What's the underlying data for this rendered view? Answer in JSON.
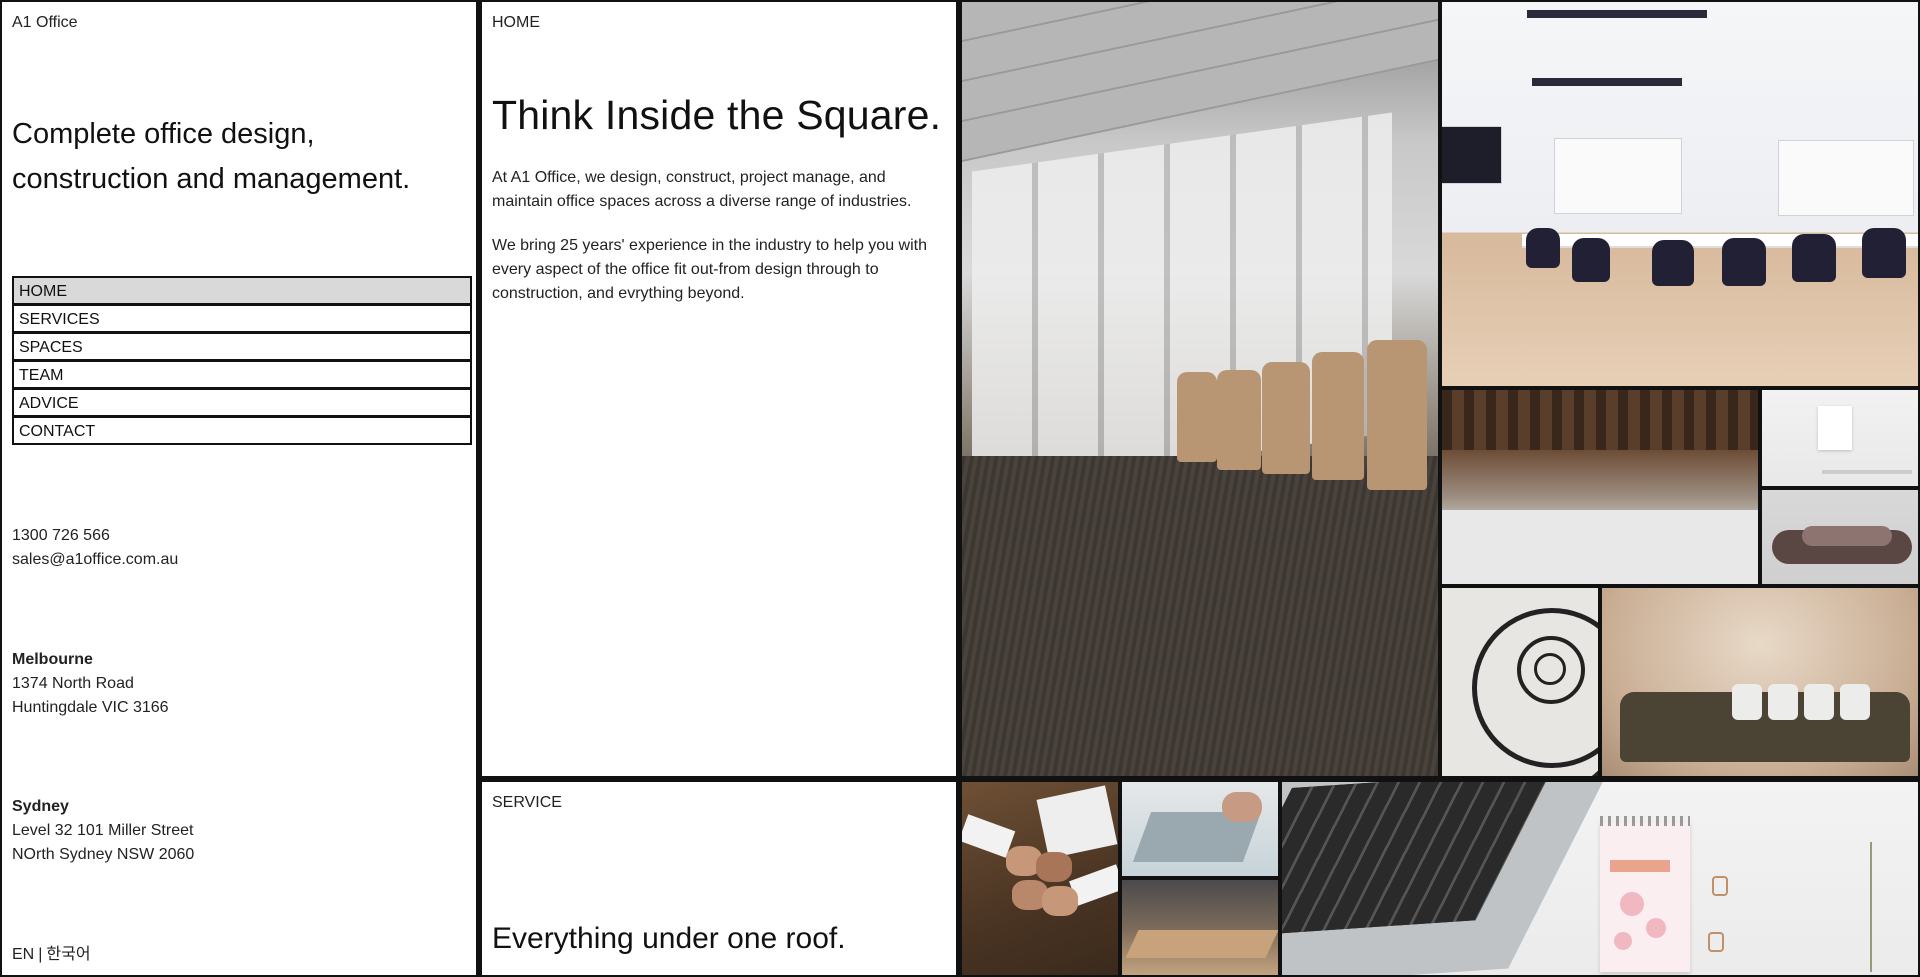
{
  "brand": "A1 Office",
  "tagline": "Complete office design, construction and management.",
  "nav": {
    "items": [
      {
        "label": "HOME",
        "active": true
      },
      {
        "label": "SERVICES",
        "active": false
      },
      {
        "label": "SPACES",
        "active": false
      },
      {
        "label": "TEAM",
        "active": false
      },
      {
        "label": "ADVICE",
        "active": false
      },
      {
        "label": "CONTACT",
        "active": false
      }
    ]
  },
  "contact": {
    "phone": "1300 726 566",
    "email": "sales@a1office.com.au"
  },
  "offices": [
    {
      "city": "Melbourne",
      "line1": "1374 North Road",
      "line2": "Huntingdale VIC 3166"
    },
    {
      "city": "Sydney",
      "line1": "Level 32 101 Miller Street",
      "line2": "NOrth Sydney NSW 2060"
    }
  ],
  "language": {
    "en": "EN",
    "separator": "|",
    "ko": "한국어"
  },
  "home": {
    "section_label": "HOME",
    "title": "Think Inside the Square.",
    "para1": "At A1 Office, we design, construct, project manage, and maintain office spaces across a diverse range of industries.",
    "para2": "We bring 25 years' experience in the industry to help you with every aspect of the office fit out-from design through to construction, and evrything beyond."
  },
  "service": {
    "section_label": "SERVICE",
    "title": "Everything under one roof."
  },
  "colors": {
    "border": "#111111",
    "nav_active_bg": "#d9d9d9",
    "panel_bg": "#ffffff"
  }
}
